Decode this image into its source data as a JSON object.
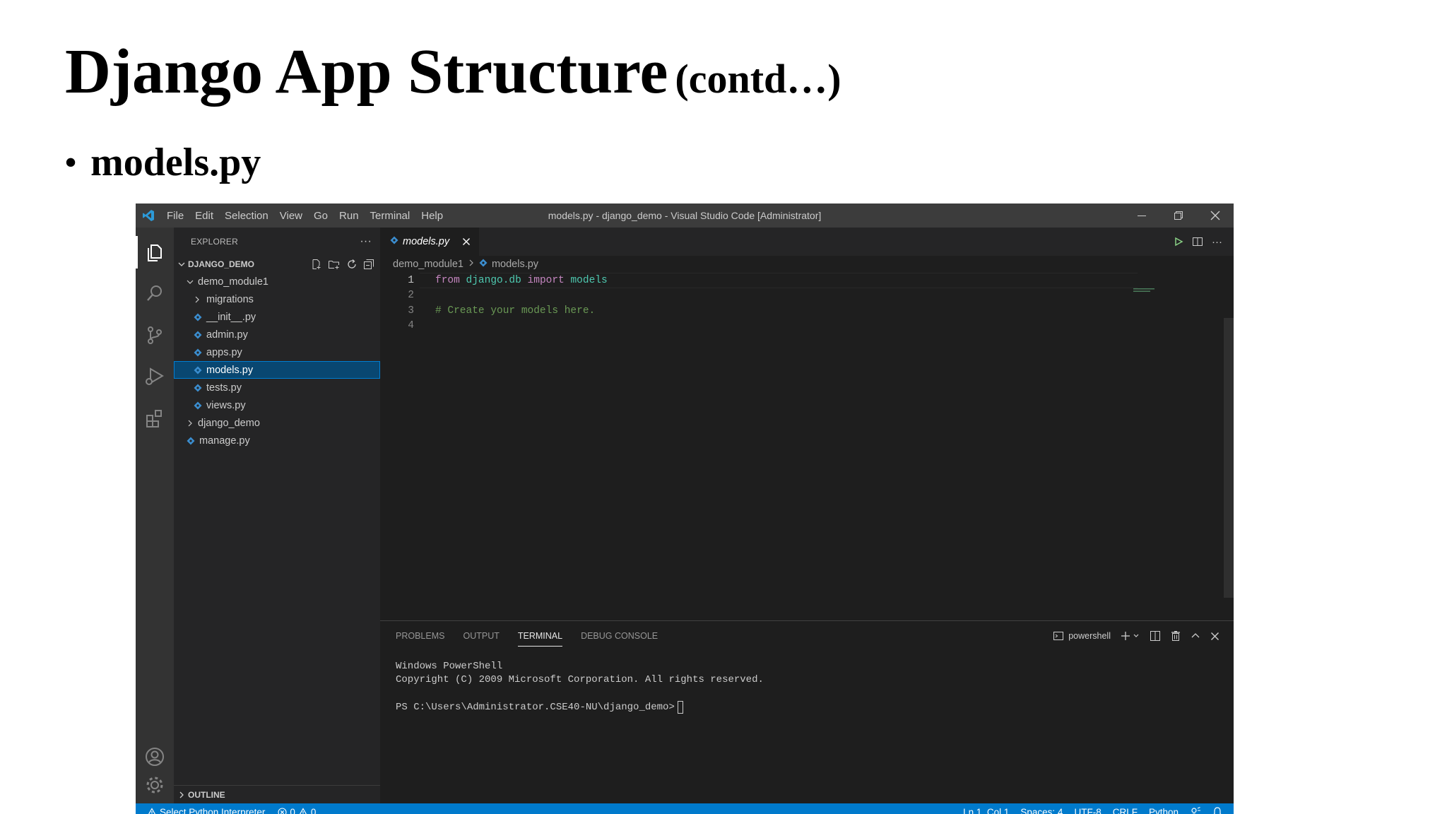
{
  "slide": {
    "title": "Django App Structure",
    "title_suffix": "(contd…)",
    "bullet": "models.py"
  },
  "window": {
    "menu": [
      "File",
      "Edit",
      "Selection",
      "View",
      "Go",
      "Run",
      "Terminal",
      "Help"
    ],
    "title": "models.py - django_demo - Visual Studio Code [Administrator]"
  },
  "explorer": {
    "header": "EXPLORER",
    "root": "DJANGO_DEMO",
    "items": [
      {
        "label": "demo_module1"
      },
      {
        "label": "migrations"
      },
      {
        "label": "__init__.py"
      },
      {
        "label": "admin.py"
      },
      {
        "label": "apps.py"
      },
      {
        "label": "models.py"
      },
      {
        "label": "tests.py"
      },
      {
        "label": "views.py"
      },
      {
        "label": "django_demo"
      },
      {
        "label": "manage.py"
      }
    ],
    "outline": "OUTLINE"
  },
  "editor": {
    "tab_label": "models.py",
    "breadcrumb": [
      "demo_module1",
      "models.py"
    ],
    "lines": [
      {
        "num": "1",
        "kw1": "from",
        "mod": "django.db",
        "kw2": "import",
        "name": "models"
      },
      {
        "num": "2"
      },
      {
        "num": "3",
        "comment": "# Create your models here."
      },
      {
        "num": "4"
      }
    ]
  },
  "panel": {
    "tabs": [
      "PROBLEMS",
      "OUTPUT",
      "TERMINAL",
      "DEBUG CONSOLE"
    ],
    "active_tab": "TERMINAL",
    "shell": "powershell",
    "terminal_lines": [
      "Windows PowerShell",
      "Copyright (C) 2009 Microsoft Corporation. All rights reserved.",
      "PS C:\\Users\\Administrator.CSE40-NU\\django_demo>"
    ]
  },
  "status": {
    "interpreter": "Select Python Interpreter",
    "errors": "0",
    "warnings": "0",
    "position": "Ln 1, Col 1",
    "spaces": "Spaces: 4",
    "encoding": "UTF-8",
    "eol": "CRLF",
    "language": "Python"
  },
  "colors": {
    "accent": "#007acc",
    "python_icon": "#3b8ed0",
    "selection": "#094771"
  }
}
